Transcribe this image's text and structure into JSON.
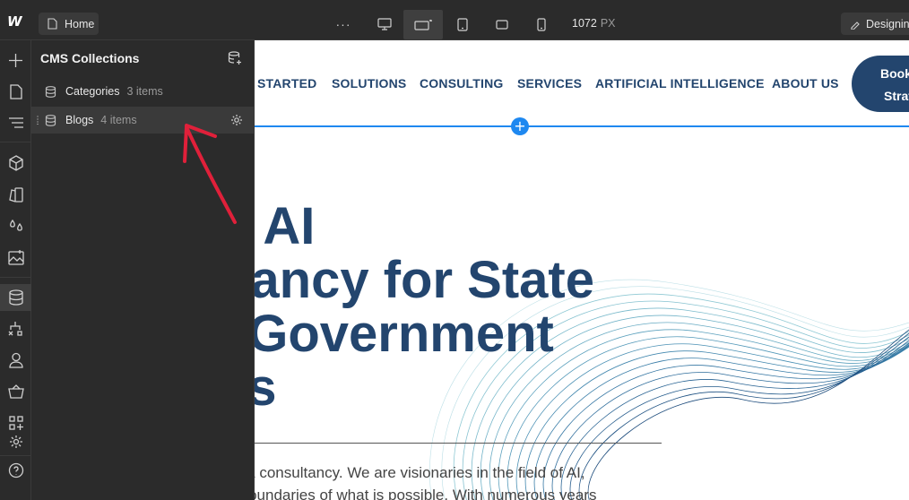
{
  "topbar": {
    "page_label": "Home",
    "more_label": "···",
    "width_value": "1072",
    "width_unit": "PX",
    "mode_label": "Designing"
  },
  "cms": {
    "title": "CMS Collections",
    "collections": [
      {
        "name": "Categories",
        "count": "3 items"
      },
      {
        "name": "Blogs",
        "count": "4 items"
      }
    ]
  },
  "site": {
    "nav": [
      "STARTED",
      "SOLUTIONS",
      "CONSULTING",
      "SERVICES",
      "ARTIFICIAL INTELLIGENCE",
      "ABOUT US"
    ],
    "cta": {
      "line1": "Book",
      "line2": "Strat"
    },
    "hero_lines": [
      "g AI",
      "ltancy for State",
      "l Government",
      "es"
    ],
    "body_lines": [
      "just a consultancy.  We are visionaries in the field of AI,",
      "he boundaries of what is possible. With numerous years"
    ]
  },
  "colors": {
    "brand_navy": "#23456e",
    "selection_blue": "#1e88f0",
    "annotation_red": "#e0203a",
    "editor_bg": "#2b2b2b"
  }
}
